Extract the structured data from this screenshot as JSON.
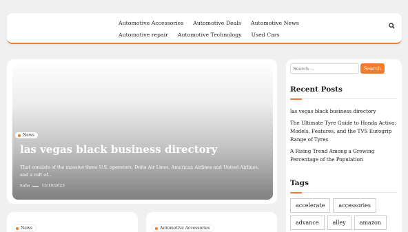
{
  "nav": {
    "items": [
      "Automotive Accessories",
      "Automotive Deals",
      "Automotive News",
      "Automotive repair",
      "Automotive Technology",
      "Used Cars"
    ],
    "search_icon": "search-icon"
  },
  "hero": {
    "category": "News",
    "title": "las vegas black business directory",
    "excerpt": "That consists of the massive three U.S. operators, Delta Air Lines, American Airlines and United Airlines, and a raft of...",
    "author": "haha",
    "date": "13/10/2023"
  },
  "cards": [
    {
      "category": "News"
    },
    {
      "category": "Automotive Accessories"
    }
  ],
  "sidebar": {
    "search_placeholder": "Search ...",
    "search_button": "Search",
    "recent_title": "Recent Posts",
    "recent_posts": [
      "las vegas black business directory",
      "The Ultimate Tyre Guide to Honda Activa: Models, Features, and the TVS Eurogrip Range of Tyres",
      "A Rising Trend Among a Growing Percentage of the Population"
    ],
    "tags_title": "Tags",
    "tags": [
      "accelerate",
      "accessories",
      "advance",
      "alley",
      "amazon"
    ]
  },
  "colors": {
    "accent": "#ef7d2d"
  }
}
